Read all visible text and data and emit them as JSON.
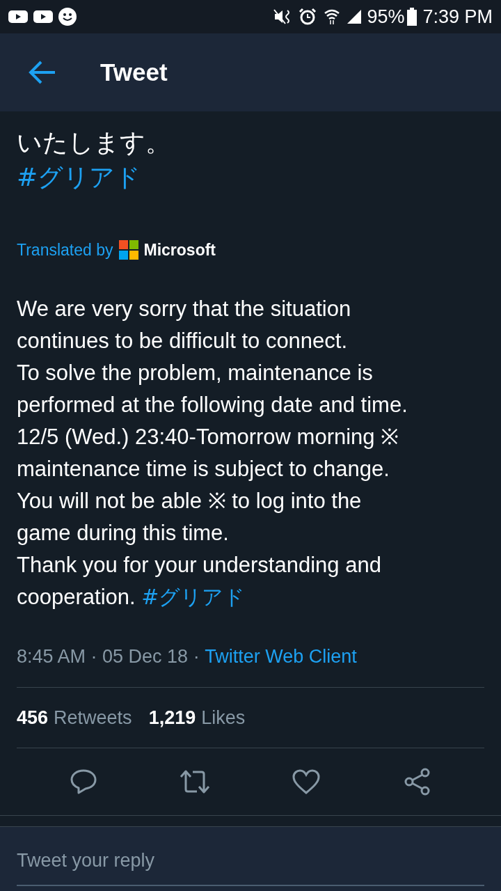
{
  "status_bar": {
    "battery": "95%",
    "time": "7:39 PM"
  },
  "header": {
    "title": "Tweet"
  },
  "original": {
    "lines": [
      "いたします。"
    ],
    "hashtag": "#グリアド"
  },
  "translation_credit": {
    "label": "Translated by",
    "provider": "Microsoft"
  },
  "translation": {
    "lines": [
      "We are very sorry that the situation",
      "continues to be difficult to connect.",
      "To solve the problem, maintenance is",
      "performed at the following date and time.",
      "12/5 (Wed.) 23:40-Tomorrow morning ※",
      "maintenance time is subject to change.",
      "You will not be able ※ to log into the",
      "game during this time.",
      "Thank you for your understanding and",
      "cooperation."
    ],
    "hashtag": "#グリアド"
  },
  "meta": {
    "time": "8:45 AM · 05 Dec 18 · ",
    "source": "Twitter Web Client"
  },
  "stats": [
    {
      "count": "456",
      "label": "Retweets"
    },
    {
      "count": "1,219",
      "label": "Likes"
    }
  ],
  "reply": {
    "placeholder": "Tweet your reply"
  }
}
